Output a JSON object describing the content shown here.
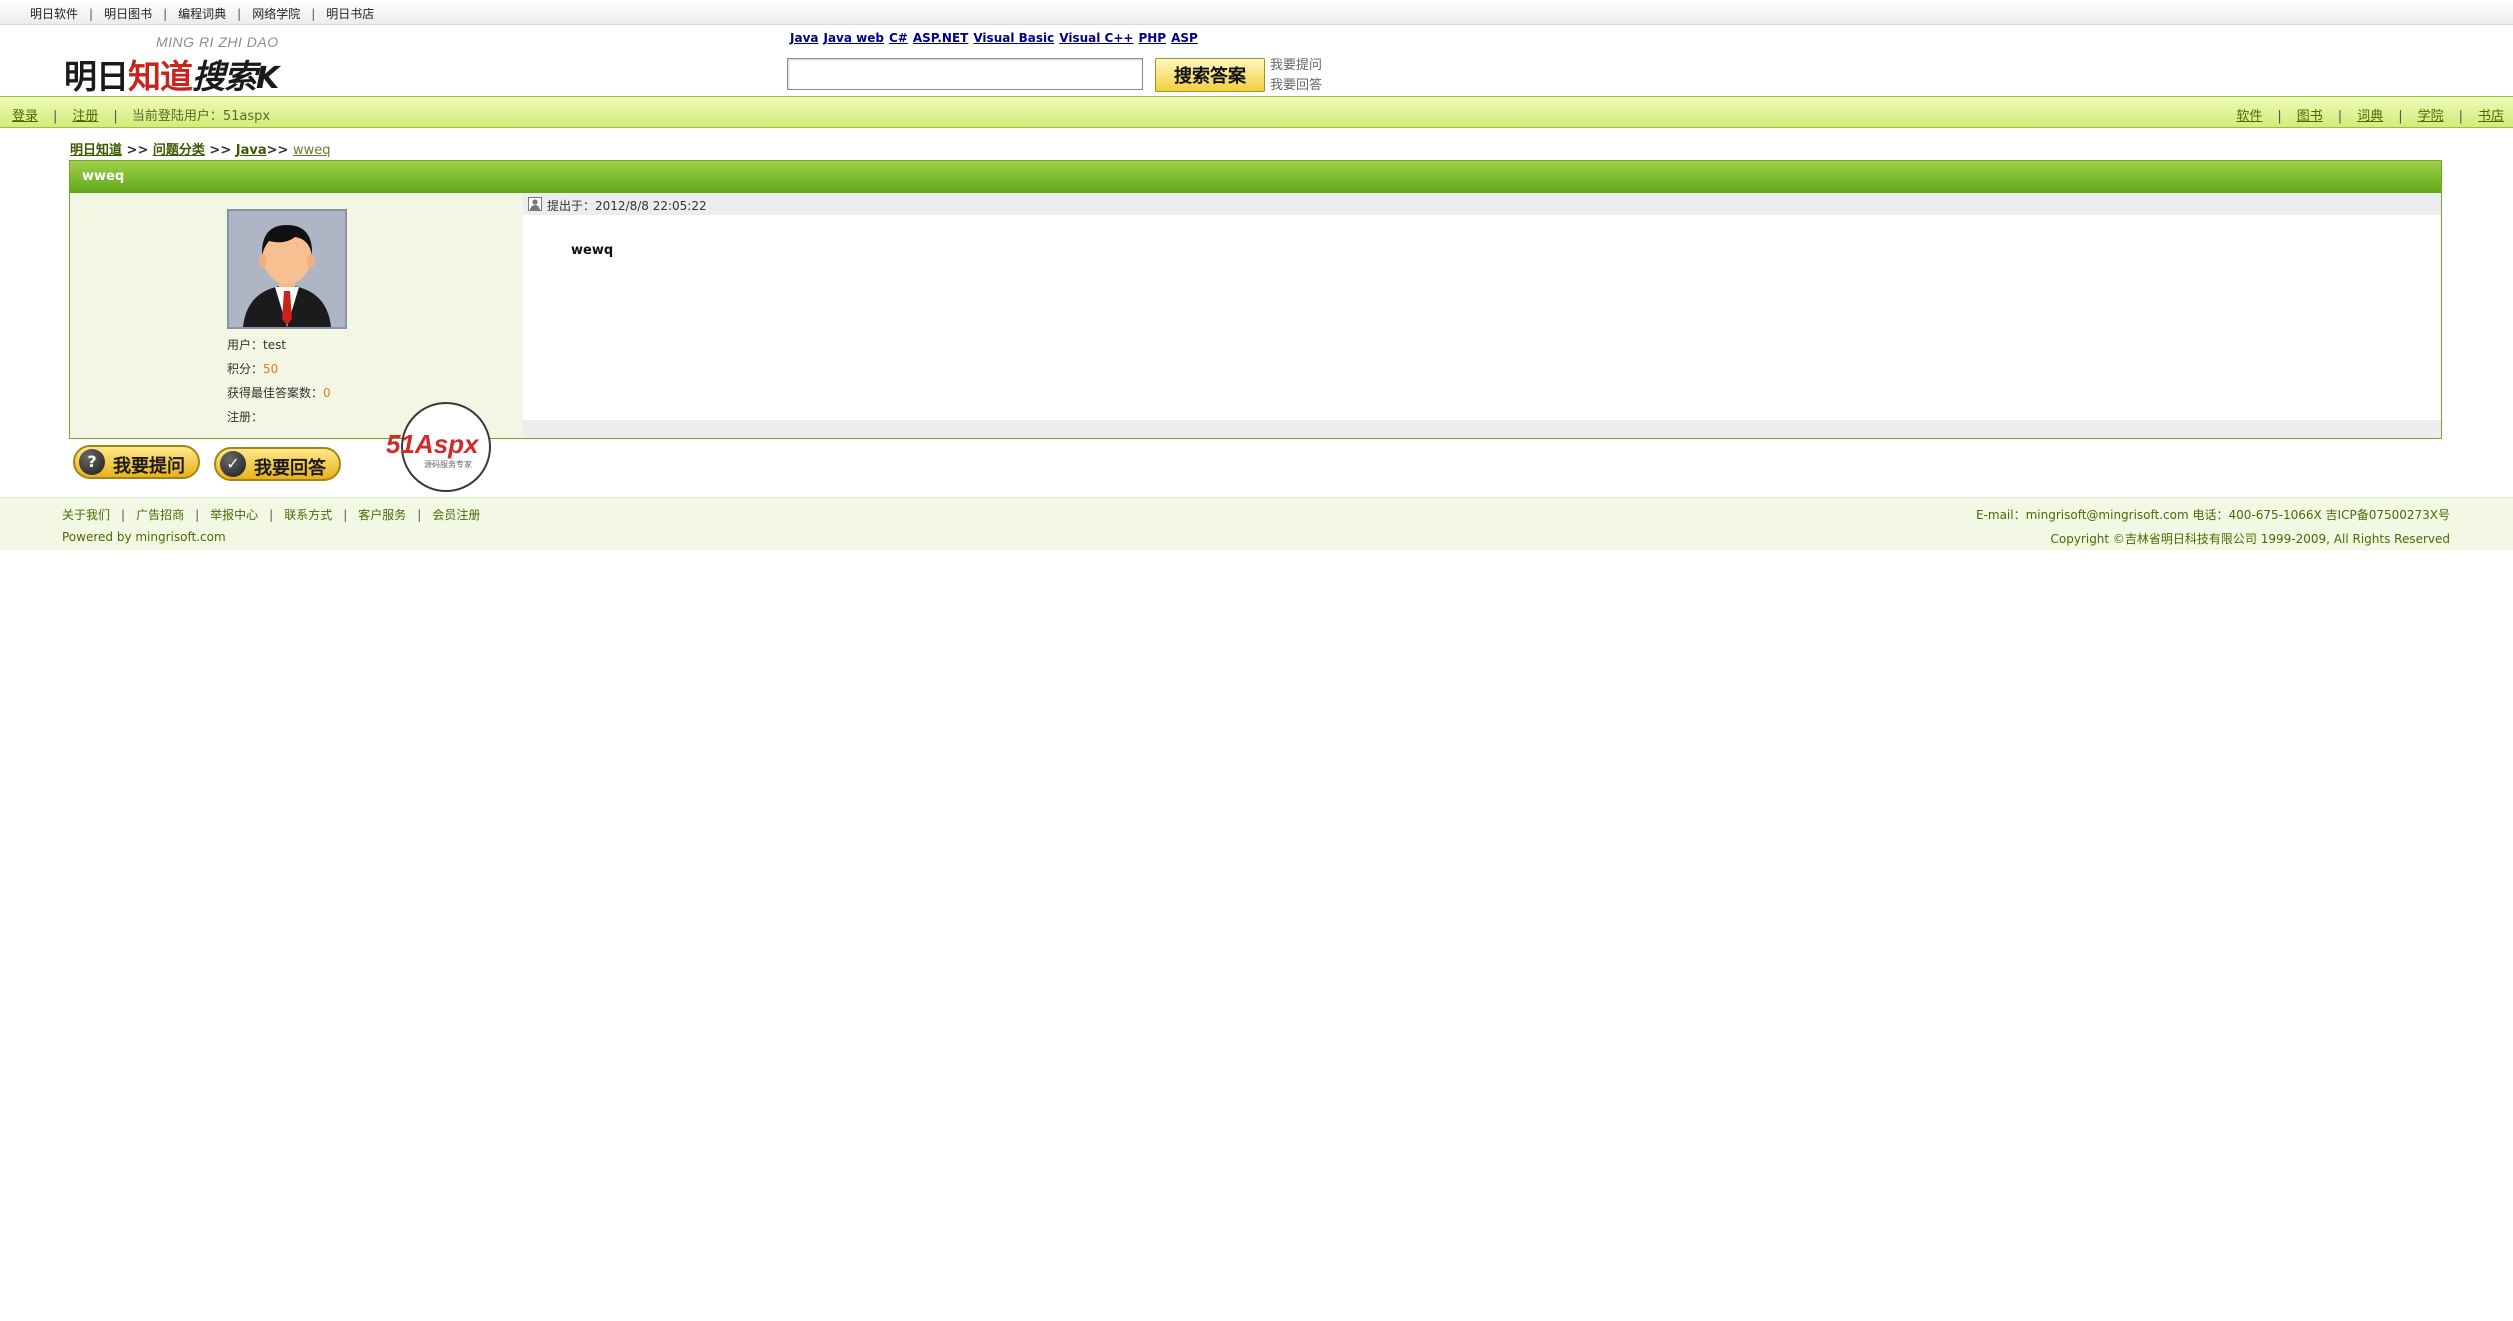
{
  "topbar": {
    "links": [
      "明日软件",
      "明日图书",
      "编程词典",
      "网络学院",
      "明日书店"
    ]
  },
  "logo": {
    "tagline": "MING RI ZHI DAO",
    "part1": "明日",
    "part2": "知道",
    "part3": "搜索",
    "part4": "K"
  },
  "search": {
    "quicklinks": [
      "Java",
      "Java web",
      "C#",
      "ASP.NET",
      "Visual Basic",
      "Visual C++",
      "PHP",
      "ASP"
    ],
    "input_value": "",
    "button_label": "搜索答案",
    "ask_link": "我要提问",
    "answer_link": "我要回答"
  },
  "navbar": {
    "login": "登录",
    "register": "注册",
    "current_user": "当前登陆用户：51aspx",
    "right_links": [
      "软件",
      "图书",
      "词典",
      "学院",
      "书店"
    ]
  },
  "breadcrumb": {
    "home": "明日知道",
    "sep": ">>",
    "category": "问题分类",
    "sub": "Java",
    "current": "wweq"
  },
  "question": {
    "title": "wweq",
    "asked_at": "提出于：2012/8/8 22:05:22",
    "content": "wewq"
  },
  "user": {
    "name_label": "用户：",
    "name": "test",
    "points_label": "积分：",
    "points": "50",
    "best_label": "获得最佳答案数：",
    "best": "0",
    "reg_label": "注册："
  },
  "actions": {
    "ask": "我要提问",
    "answer": "我要回答"
  },
  "badge": {
    "brand": "51Aspx",
    "sub": "源码服务专家"
  },
  "footer": {
    "links": [
      "关于我们",
      "广告招商",
      "举报中心",
      "联系方式",
      "客户服务",
      "会员注册"
    ],
    "powered": "Powered by mingrisoft.com",
    "contact": "E-mail：mingrisoft@mingrisoft.com  电话：400-675-1066X  吉ICP备07500273X号",
    "copyright": "Copyright ©吉林省明日科技有限公司 1999-2009, All Rights Reserved"
  },
  "colors": {
    "accent_green": "#8cc63f",
    "header_green": "#5fa618",
    "link_blue": "#00008b",
    "orange": "#e07a1f"
  }
}
